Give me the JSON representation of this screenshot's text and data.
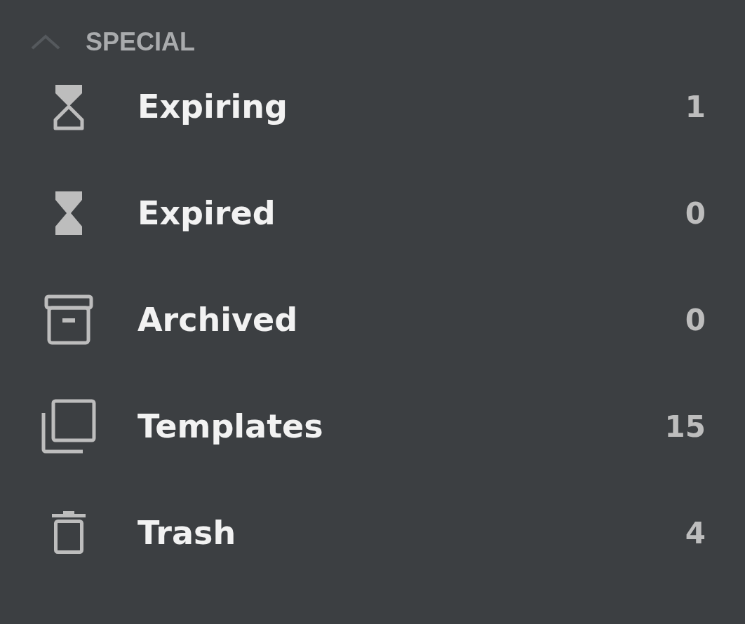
{
  "section": {
    "title": "SPECIAL",
    "expanded": true
  },
  "items": [
    {
      "kind": "expiring",
      "label": "Expiring",
      "count": "1"
    },
    {
      "kind": "expired",
      "label": "Expired",
      "count": "0"
    },
    {
      "kind": "archived",
      "label": "Archived",
      "count": "0"
    },
    {
      "kind": "templates",
      "label": "Templates",
      "count": "15"
    },
    {
      "kind": "trash",
      "label": "Trash",
      "count": "4"
    }
  ]
}
